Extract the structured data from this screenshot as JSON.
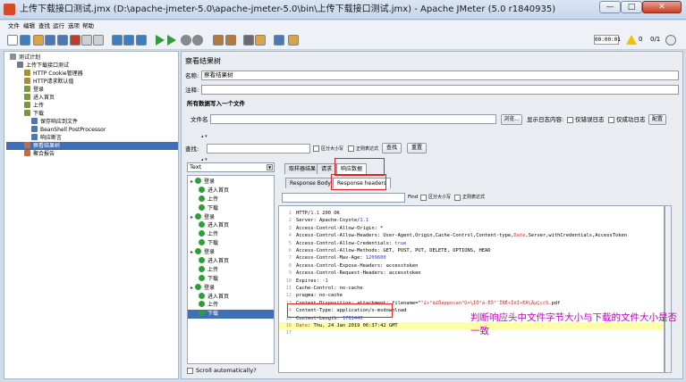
{
  "window": {
    "title": "上传下载接口测试.jmx (D:\\apache-jmeter-5.0\\apache-jmeter-5.0\\bin\\上传下载接口测试.jmx) - Apache JMeter (5.0 r1840935)",
    "minimize": "—",
    "maximize": "□",
    "close": "✕"
  },
  "menu": [
    "文件",
    "编辑",
    "查找",
    "运行",
    "选项",
    "帮助"
  ],
  "status": {
    "timer": "00:00:01",
    "warnings": "0",
    "threads": "0/1"
  },
  "tree": {
    "nodes": [
      {
        "label": "测试计划",
        "indent": 0,
        "color": "#8a8fa0"
      },
      {
        "label": "上传下载接口测试",
        "indent": 1,
        "color": "#6c7a8e"
      },
      {
        "label": "HTTP Cookie管理器",
        "indent": 2,
        "color": "#b08c2a"
      },
      {
        "label": "HTTP请求默认值",
        "indent": 2,
        "color": "#b08c2a"
      },
      {
        "label": "登录",
        "indent": 2,
        "color": "#7a9a3a"
      },
      {
        "label": "进入首页",
        "indent": 2,
        "color": "#7a9a3a"
      },
      {
        "label": "上传",
        "indent": 2,
        "color": "#7a9a3a"
      },
      {
        "label": "下载",
        "indent": 2,
        "color": "#7a9a3a"
      },
      {
        "label": "保存响应到文件",
        "indent": 3,
        "color": "#4a78b8"
      },
      {
        "label": "BeanShell PostProcessor",
        "indent": 3,
        "color": "#4a78b8"
      },
      {
        "label": "响应断言",
        "indent": 3,
        "color": "#4a78b8"
      },
      {
        "label": "察看结果树",
        "indent": 2,
        "color": "#c86a3a",
        "selected": true
      },
      {
        "label": "聚合报告",
        "indent": 2,
        "color": "#c86a3a"
      }
    ]
  },
  "panel": {
    "heading": "察看结果树",
    "name_label": "名称:",
    "name_value": "察看结果树",
    "comment_label": "注释:",
    "comment_value": "",
    "file_section_title": "所有数据写入一个文件",
    "filename_label": "文件名",
    "filename_value": "",
    "browse_button": "浏览...",
    "log_content_label": "显示日志内容:",
    "errors_only_label": "仅错误日志",
    "success_only_label": "仅成功日志",
    "configure_button": "配置",
    "search_label": "查找:",
    "search_value": "",
    "case_sensitive_label": "区分大小写",
    "regex_label": "正则表达式",
    "search_button": "查找",
    "reset_button": "重置",
    "renderer_value": "Text",
    "scroll_auto_label": "Scroll automatically?",
    "collapse_marker": "▴ ▾"
  },
  "results": {
    "items": [
      {
        "label": "登录",
        "expand": true
      },
      {
        "label": "进入首页",
        "expand": false
      },
      {
        "label": "上传",
        "expand": false
      },
      {
        "label": "下载",
        "expand": false
      },
      {
        "label": "登录",
        "expand": true
      },
      {
        "label": "进入首页",
        "expand": false
      },
      {
        "label": "上传",
        "expand": false
      },
      {
        "label": "下载",
        "expand": false
      },
      {
        "label": "登录",
        "expand": true
      },
      {
        "label": "进入首页",
        "expand": false
      },
      {
        "label": "上传",
        "expand": false
      },
      {
        "label": "下载",
        "expand": false
      },
      {
        "label": "登录",
        "expand": true
      },
      {
        "label": "进入首页",
        "expand": false
      },
      {
        "label": "上传",
        "expand": false
      },
      {
        "label": "下载",
        "expand": false,
        "selected": true
      }
    ]
  },
  "tabs": {
    "main": [
      "取样器结果",
      "请求",
      "响应数据"
    ],
    "sub": [
      "Response Body",
      "Response headers"
    ]
  },
  "response_find": {
    "label": "Find",
    "case_label": "区分大小写",
    "regex_label": "正则表达式"
  },
  "response_lines": [
    {
      "n": "1",
      "parts": [
        [
          "HTTP/",
          ""
        ],
        [
          "1.1",
          "val"
        ],
        [
          " 200 OK",
          ""
        ]
      ]
    },
    {
      "n": "2",
      "parts": [
        [
          "Server: Apache-Coyote/",
          ""
        ],
        [
          "1.1",
          "val"
        ]
      ]
    },
    {
      "n": "3",
      "parts": [
        [
          "Access-Control-Allow-Origin: *",
          ""
        ]
      ]
    },
    {
      "n": "4",
      "parts": [
        [
          "Access-Control-Allow-Headers: User-Agent,Origin,Cache-Control,Content-type,",
          ""
        ],
        [
          "Date",
          "kw"
        ],
        [
          ",Server,withCredentials,AccessToken",
          ""
        ]
      ]
    },
    {
      "n": "5",
      "parts": [
        [
          "Access-Control-Allow-Credentials: ",
          ""
        ],
        [
          "true",
          "val"
        ]
      ]
    },
    {
      "n": "6",
      "parts": [
        [
          "Access-Control-Allow-Methods: GET, POST, PUT, DELETE, OPTIONS, HEAD",
          ""
        ]
      ]
    },
    {
      "n": "7",
      "parts": [
        [
          "Access-Control-Max-Age: ",
          ""
        ],
        [
          "1209600",
          "val"
        ]
      ]
    },
    {
      "n": "8",
      "parts": [
        [
          "Access-Control-Expose-Headers: accesstoken",
          ""
        ]
      ]
    },
    {
      "n": "9",
      "parts": [
        [
          "Access-Control-Request-Headers: accesstoken",
          ""
        ]
      ]
    },
    {
      "n": "10",
      "parts": [
        [
          "Expires: ",
          ""
        ],
        [
          "-1",
          "val"
        ]
      ]
    },
    {
      "n": "11",
      "parts": [
        [
          "Cache-Control: no-cache",
          ""
        ]
      ]
    },
    {
      "n": "12",
      "parts": [
        [
          "pragma: no-cache",
          ""
        ]
      ]
    },
    {
      "n": "13",
      "parts": [
        [
          "Content-Disposition: attachment; filename=\"",
          ""
        ],
        [
          "\"£÷°ã£Ôappocan³Ù×¼ÌÔ²á-ÊÔ³¨ÎÑÊ×ÎëÌ×ÉÃ¼ÄµÇcc5",
          "kw"
        ],
        [
          ".pdf",
          ""
        ]
      ]
    },
    {
      "n": "14",
      "parts": [
        [
          "Content-Type: application/x-msdownload",
          ""
        ]
      ]
    },
    {
      "n": "15",
      "parts": [
        [
          "Content-Length: ",
          ""
        ],
        [
          "1781440",
          "val"
        ]
      ]
    },
    {
      "n": "16",
      "parts": [
        [
          "Date",
          "kw"
        ],
        [
          ": Thu, 24 Jan 2019 06:37:42 GMT",
          ""
        ]
      ]
    },
    {
      "n": "17",
      "parts": [
        [
          "",
          ""
        ]
      ]
    }
  ],
  "annotation": "判断响应头中文件字节大小与下载的文件大小是否一致",
  "icons": {
    "toolbar": [
      "new-icon",
      "template-icon",
      "open-icon",
      "save-icon",
      "save-as-icon",
      "cut-icon",
      "copy-icon",
      "paste-icon",
      "expand-icon",
      "collapse-icon",
      "toggle-icon",
      "start-icon",
      "start-no-pause-icon",
      "stop-icon",
      "shutdown-icon",
      "clear-icon",
      "clear-all-icon",
      "search-icon",
      "reset-search-icon",
      "function-helper-icon",
      "help-icon"
    ],
    "colors": [
      "#ffffff",
      "#3a7fc4",
      "#d9a441",
      "#4a78b8",
      "#4a78b8",
      "#c0392b",
      "#d0d0d0",
      "#d0d0d0",
      "#3a7fc4",
      "#3a7fc4",
      "#3a7fc4",
      "#2e9e3a",
      "#2e9e3a",
      "#8a8a8a",
      "#8a8a8a",
      "#b37a3a",
      "#b37a3a",
      "#6c6c6c",
      "#d9a441",
      "#4a78b8",
      "#d9a441"
    ]
  }
}
